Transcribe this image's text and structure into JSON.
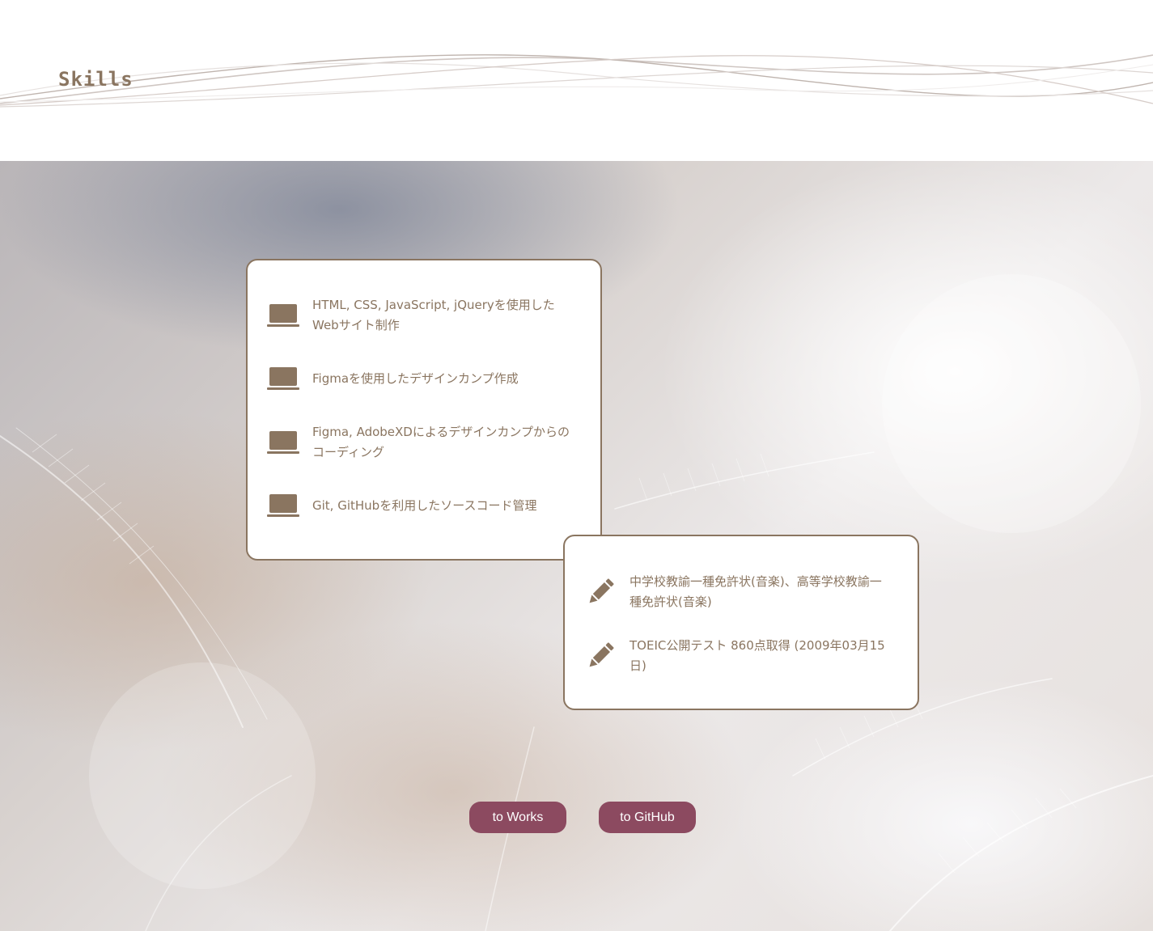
{
  "header": {
    "title": "Skills"
  },
  "skills": {
    "items": [
      {
        "icon": "laptop-icon",
        "text": "HTML, CSS, JavaScript, jQueryを使用した\nWebサイト制作"
      },
      {
        "icon": "laptop-icon",
        "text": "Figmaを使用したデザインカンプ作成"
      },
      {
        "icon": "laptop-icon",
        "text": "Figma, AdobeXDによるデザインカンプからの\nコーディング"
      },
      {
        "icon": "laptop-icon",
        "text": "Git, GitHubを利用したソースコード管理"
      }
    ]
  },
  "certifications": {
    "items": [
      {
        "icon": "pencil-icon",
        "text": "中学校教諭一種免許状(音楽)、高等学校教諭一\n種免許状(音楽)"
      },
      {
        "icon": "pencil-icon",
        "text": "TOEIC公開テスト 860点取得 (2009年03月15\n日)"
      }
    ]
  },
  "buttons": {
    "works_label": "to Works",
    "github_label": "to GitHub"
  },
  "colors": {
    "accent_brown": "#8a7560",
    "button_plum": "#8c4a60"
  }
}
